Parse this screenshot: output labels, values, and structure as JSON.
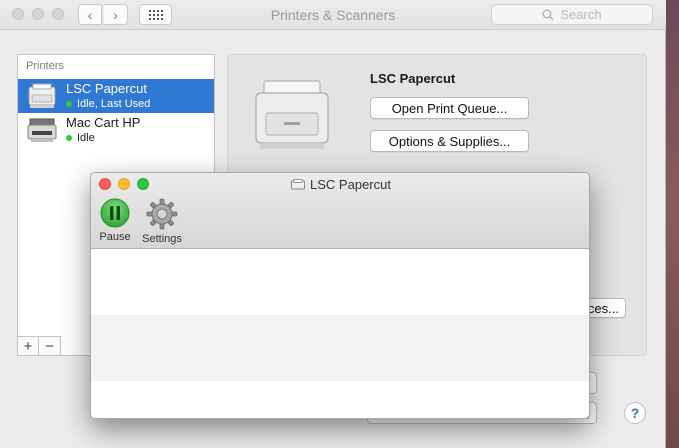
{
  "window": {
    "title": "Printers & Scanners",
    "search_placeholder": "Search"
  },
  "printers_list": {
    "header": "Printers",
    "items": [
      {
        "name": "LSC Papercut",
        "status": "Idle, Last Used",
        "status_color": "#2ecc40",
        "selected": true
      },
      {
        "name": "Mac Cart HP",
        "status": "Idle",
        "status_color": "#2ecc40",
        "selected": false
      }
    ],
    "add_label": "+",
    "remove_label": "−"
  },
  "detail": {
    "printer_name": "LSC Papercut",
    "open_queue_label": "Open Print Queue...",
    "options_label": "Options & Supplies...",
    "partial_button_label": "ces...",
    "help_label": "?"
  },
  "queue_window": {
    "title": "LSC Papercut",
    "toolbar": [
      {
        "label": "Pause",
        "icon": "pause-icon"
      },
      {
        "label": "Settings",
        "icon": "gear-icon"
      }
    ]
  },
  "colors": {
    "selection": "#2f78d3",
    "pause_green": "#35b73d"
  }
}
